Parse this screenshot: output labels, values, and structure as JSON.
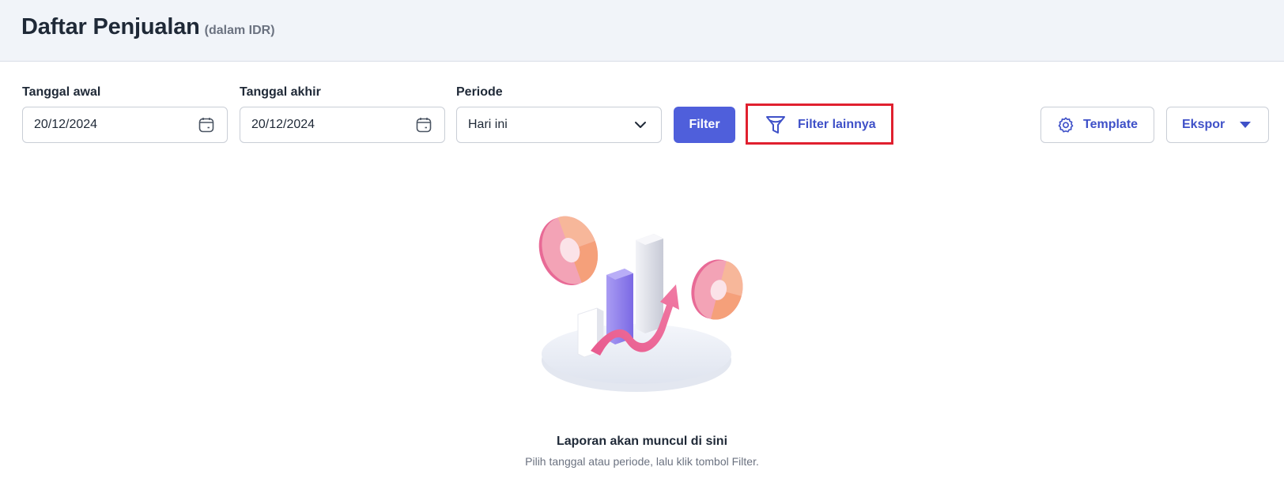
{
  "header": {
    "title": "Daftar Penjualan",
    "subtitle": "(dalam IDR)"
  },
  "filters": {
    "start_date": {
      "label": "Tanggal awal",
      "value": "20/12/2024"
    },
    "end_date": {
      "label": "Tanggal akhir",
      "value": "20/12/2024"
    },
    "period": {
      "label": "Periode",
      "value": "Hari ini"
    },
    "filter_button": "Filter",
    "more_filters_button": "Filter lainnya"
  },
  "actions": {
    "template_button": "Template",
    "export_button": "Ekspor"
  },
  "empty_state": {
    "title": "Laporan akan muncul di sini",
    "subtitle": "Pilih tanggal atau periode, lalu klik tombol Filter."
  },
  "icons": {
    "start_date": "calendar-icon",
    "end_date": "calendar-icon",
    "period": "chevron-down-icon",
    "more_filters": "funnel-icon",
    "template": "gear-icon",
    "export": "caret-down-icon",
    "illustration": "chart-illustration"
  },
  "colors": {
    "primary": "#4f5fdb",
    "link": "#3f51c8",
    "highlight": "#e0202f",
    "header_bg": "#f1f4f9"
  }
}
